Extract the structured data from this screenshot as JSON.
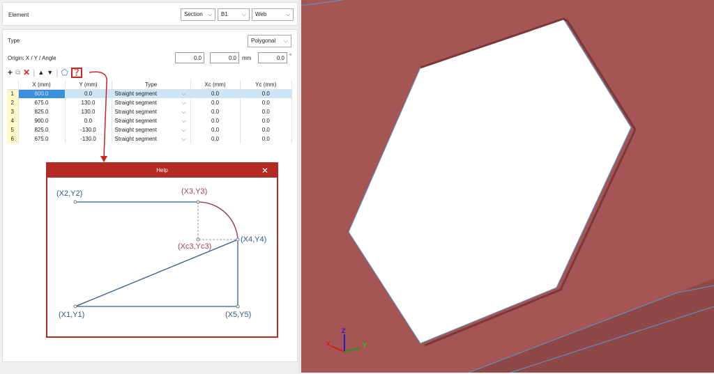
{
  "element": {
    "label": "Element",
    "section": "Section",
    "b": "B1",
    "part": "Web"
  },
  "type": {
    "label": "Type",
    "value": "Polygonal"
  },
  "origin": {
    "label": "Origin: X / Y / Angle",
    "x": "0.0",
    "y": "0.0",
    "unit": "mm",
    "angle": "0.0",
    "angle_unit": "°"
  },
  "table": {
    "headers": [
      "X (mm)",
      "Y (mm)",
      "Type",
      "Xc (mm)",
      "Yc (mm)"
    ],
    "rows": [
      {
        "n": "1",
        "x": "600.0",
        "y": "0.0",
        "type": "Straight segment",
        "xc": "0.0",
        "yc": "0.0"
      },
      {
        "n": "2",
        "x": "675.0",
        "y": "130.0",
        "type": "Straight segment",
        "xc": "0.0",
        "yc": "0.0"
      },
      {
        "n": "3",
        "x": "825.0",
        "y": "130.0",
        "type": "Straight segment",
        "xc": "0.0",
        "yc": "0.0"
      },
      {
        "n": "4",
        "x": "900.0",
        "y": "0.0",
        "type": "Straight segment",
        "xc": "0.0",
        "yc": "0.0"
      },
      {
        "n": "5",
        "x": "825.0",
        "y": "-130.0",
        "type": "Straight segment",
        "xc": "0.0",
        "yc": "0.0"
      },
      {
        "n": "6",
        "x": "675.0",
        "y": "-130.0",
        "type": "Straight segment",
        "xc": "0.0",
        "yc": "0.0"
      }
    ]
  },
  "help": {
    "title": "Help",
    "close": "✕",
    "labels": {
      "p2": "(X2,Y2)",
      "p3": "(X3,Y3)",
      "p4": "(X4,Y4)",
      "pc": "(Xc3,Yc3)",
      "p1": "(X1,Y1)",
      "p5": "(X5,Y5)"
    }
  },
  "axes": {
    "x": "X",
    "y": "Y",
    "z": "Z"
  },
  "colors": {
    "accent": "#b32a22",
    "view_bg": "#a65555",
    "diagram_blue": "#2b5a8c",
    "arc": "#a5404a"
  }
}
